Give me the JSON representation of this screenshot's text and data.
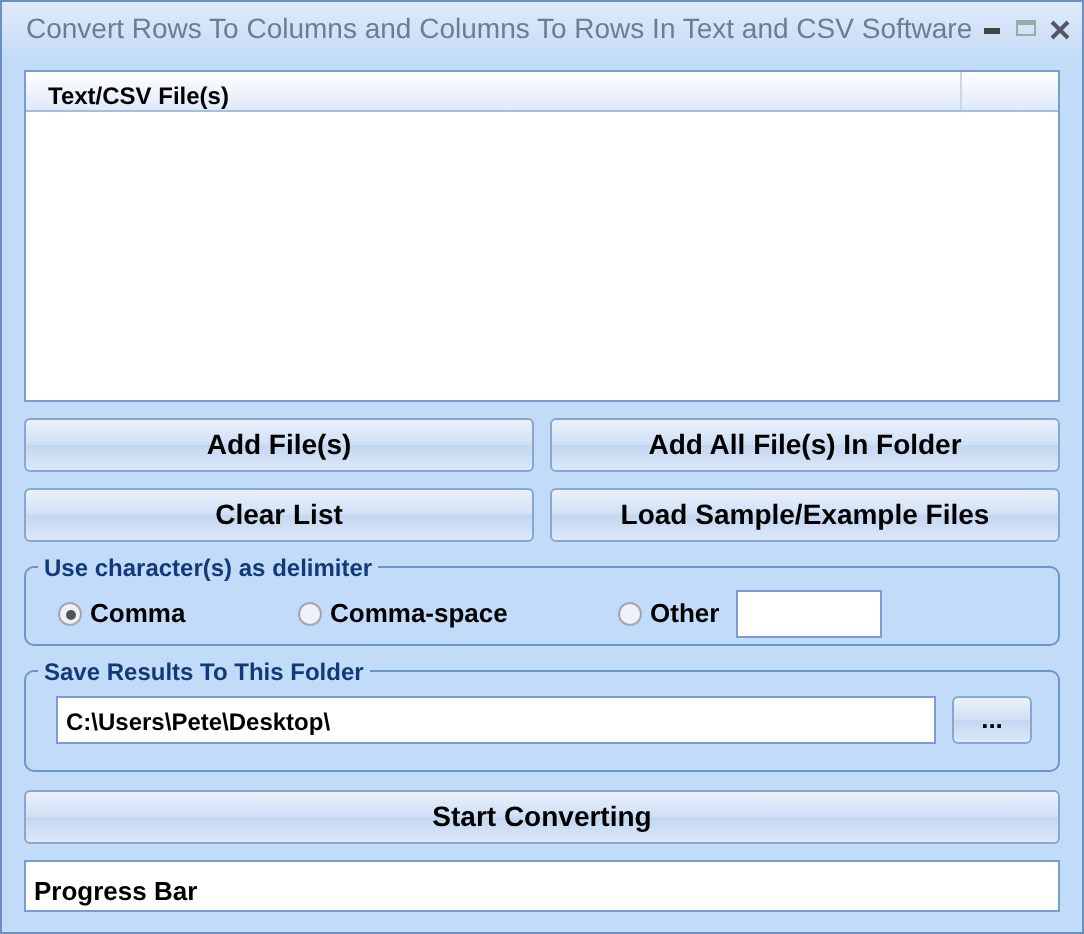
{
  "window": {
    "title": "Convert Rows To Columns and Columns To Rows In Text and CSV Software"
  },
  "file_list": {
    "columns": [
      "Text/CSV File(s)"
    ]
  },
  "buttons": [
    {
      "label": "Add File(s)"
    },
    {
      "label": "Add All File(s) In Folder"
    },
    {
      "label": "Clear List"
    },
    {
      "label": "Load Sample/Example Files"
    }
  ],
  "delimiter": {
    "legend": "Use character(s) as delimiter",
    "options": [
      {
        "label": "Comma",
        "selected": true
      },
      {
        "label": "Comma-space",
        "selected": false
      },
      {
        "label": "Other",
        "selected": false
      }
    ]
  },
  "output": {
    "legend": "Save Results To This Folder",
    "path": "C:\\Users\\Pete\\Desktop\\",
    "browse": "..."
  },
  "start_button": "Start Converting",
  "progress": {
    "text": "Progress Bar"
  }
}
